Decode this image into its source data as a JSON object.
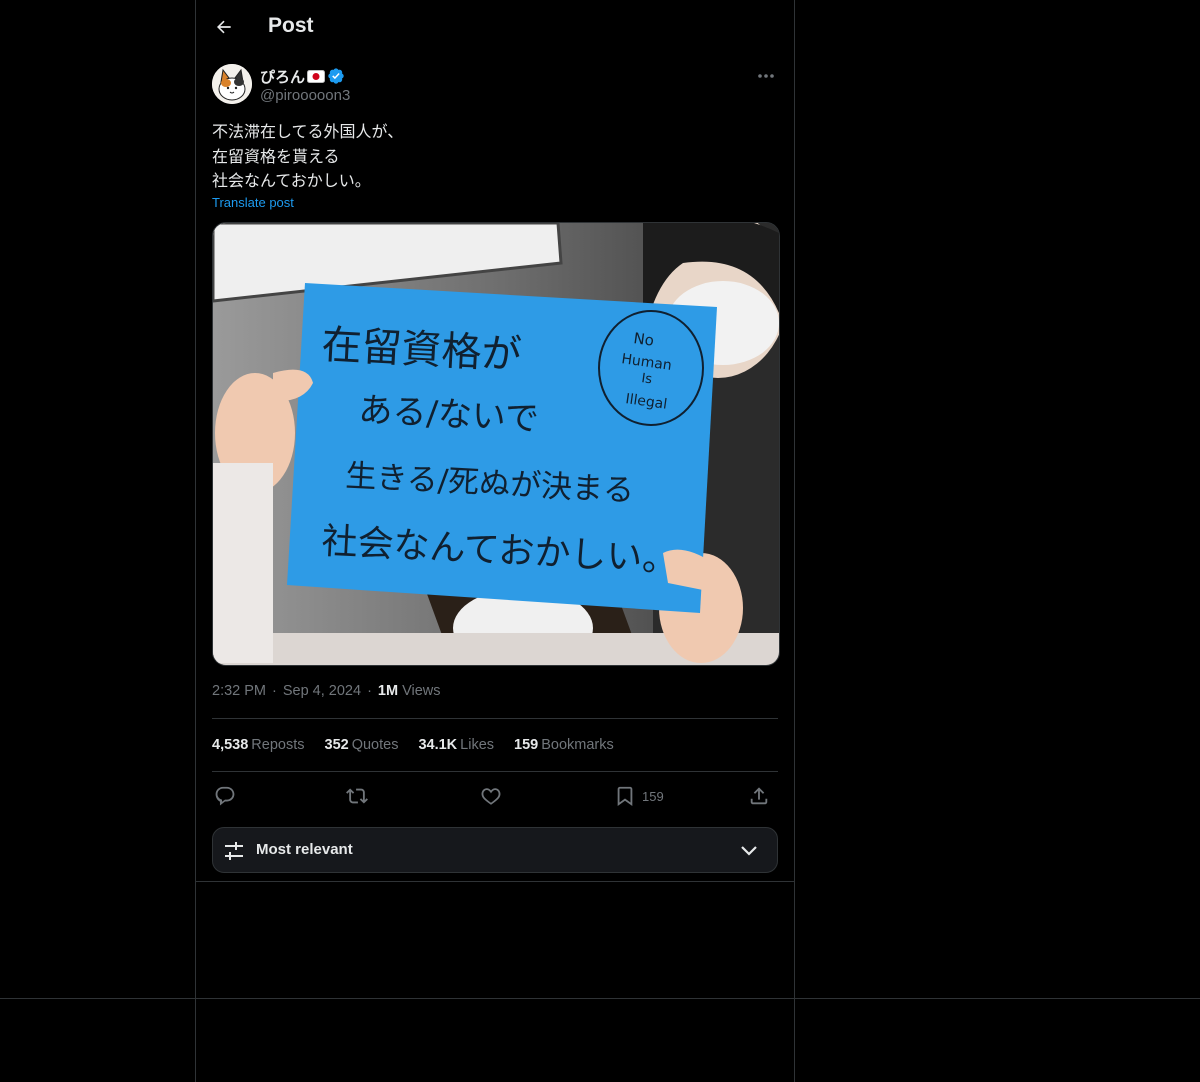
{
  "header": {
    "title": "Post",
    "back_icon": "arrow-left-icon"
  },
  "author": {
    "display_name": "ぴろん",
    "flag_icon": "japan-flag-icon",
    "verified_icon": "verified-badge-icon",
    "handle": "@pirooooon3",
    "more_icon": "ellipsis-icon"
  },
  "tweet": {
    "text": "不法滞在してる外国人が、\n在留資格を貰える\n社会なんておかしい。",
    "translate_label": "Translate post"
  },
  "media": {
    "sign_lines": [
      "在留資格が",
      "ある/ないで",
      "生きる/死ぬが決まる",
      "社会なんておかしい。"
    ],
    "badge_lines": [
      "No",
      "Human",
      "Is",
      "Illegal"
    ]
  },
  "meta": {
    "time": "2:32 PM",
    "separator": "·",
    "date": "Sep 4, 2024",
    "views_count": "1M",
    "views_label": "Views"
  },
  "stats": [
    {
      "count": "4,538",
      "label": "Reposts"
    },
    {
      "count": "352",
      "label": "Quotes"
    },
    {
      "count": "34.1K",
      "label": "Likes"
    },
    {
      "count": "159",
      "label": "Bookmarks"
    }
  ],
  "actions": {
    "reply_icon": "reply-icon",
    "repost_icon": "repost-icon",
    "like_icon": "heart-icon",
    "bookmark_icon": "bookmark-icon",
    "bookmark_count": "159",
    "share_icon": "share-icon"
  },
  "sort": {
    "label": "Most relevant",
    "icon": "sliders-icon",
    "chevron": "chevron-down-icon"
  },
  "colors": {
    "background": "#000000",
    "text": "#e7e9ea",
    "muted": "#71767b",
    "accent": "#1d9bf0",
    "border": "#2f3336",
    "sign_blue": "#2e9be6"
  }
}
